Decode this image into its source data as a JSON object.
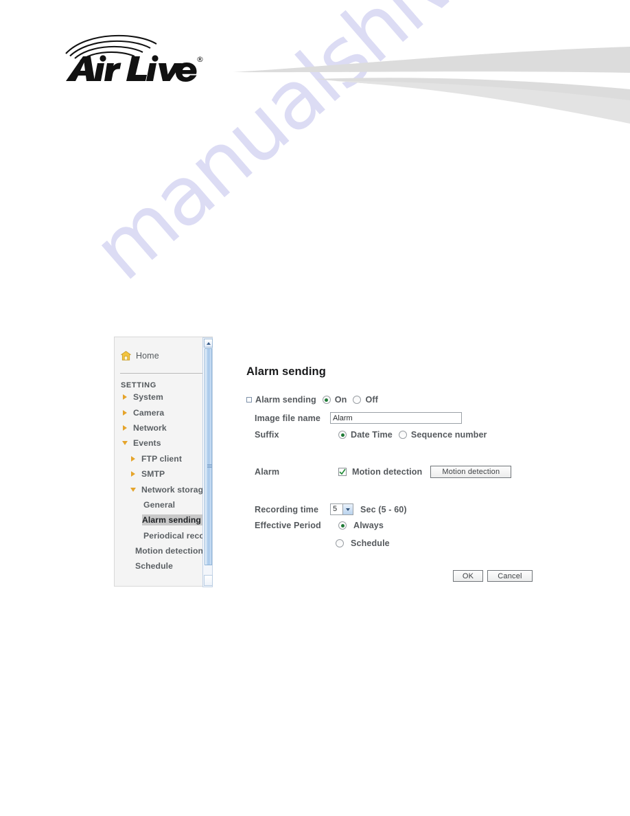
{
  "brand": {
    "logo_text": "Air Live",
    "registered_mark": "®"
  },
  "watermark": {
    "text": "manualshive.com",
    "color": "#dcdcf4"
  },
  "sidebar": {
    "home": {
      "label": "Home",
      "icon": "home-icon"
    },
    "section_label": "SETTING",
    "items": [
      {
        "label": "System",
        "level": 1,
        "arrow": "right",
        "selected": false
      },
      {
        "label": "Camera",
        "level": 1,
        "arrow": "right",
        "selected": false
      },
      {
        "label": "Network",
        "level": 1,
        "arrow": "right",
        "selected": false
      },
      {
        "label": "Events",
        "level": 1,
        "arrow": "down",
        "selected": false
      },
      {
        "label": "FTP client",
        "level": 2,
        "arrow": "right",
        "selected": false
      },
      {
        "label": "SMTP",
        "level": 2,
        "arrow": "right",
        "selected": false
      },
      {
        "label": "Network storage",
        "level": 2,
        "arrow": "down",
        "selected": false
      },
      {
        "label": "General",
        "level": 3,
        "arrow": "none",
        "selected": false
      },
      {
        "label": "Alarm sending",
        "level": 3,
        "arrow": "none",
        "selected": true
      },
      {
        "label": "Periodical reco",
        "level": 3,
        "arrow": "none",
        "selected": false
      },
      {
        "label": "Motion detection",
        "level": 3.5,
        "arrow": "none",
        "selected": false
      },
      {
        "label": "Schedule",
        "level": 3.5,
        "arrow": "none",
        "selected": false
      }
    ]
  },
  "panel": {
    "title": "Alarm sending",
    "alarm_sending": {
      "label": "Alarm sending",
      "options": [
        {
          "label": "On",
          "selected": true
        },
        {
          "label": "Off",
          "selected": false
        }
      ]
    },
    "image_file_name": {
      "label": "Image file name",
      "value": "Alarm",
      "placeholder": ""
    },
    "suffix": {
      "label": "Suffix",
      "options": [
        {
          "label": "Date Time",
          "selected": true
        },
        {
          "label": "Sequence number",
          "selected": false
        }
      ]
    },
    "alarm": {
      "label": "Alarm",
      "checkbox_label": "Motion detection",
      "checked": true,
      "button_label": "Motion detection"
    },
    "recording_time": {
      "label": "Recording time",
      "value": "5",
      "unit_text": "Sec (5 - 60)"
    },
    "effective_period": {
      "label": "Effective Period",
      "options": [
        {
          "label": "Always",
          "selected": true
        },
        {
          "label": "Schedule",
          "selected": false
        }
      ]
    },
    "buttons": {
      "ok": "OK",
      "cancel": "Cancel"
    }
  }
}
